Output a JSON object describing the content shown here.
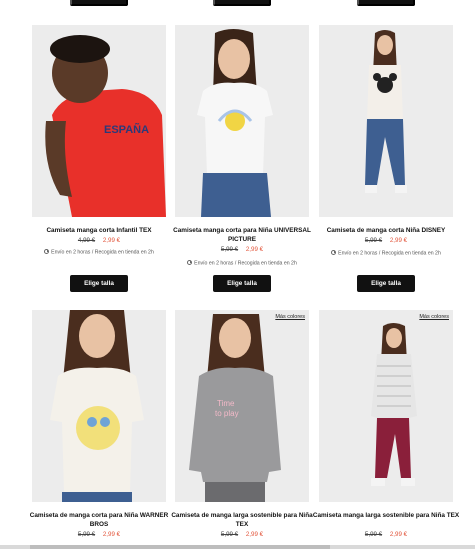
{
  "top_row": {
    "button_label": "Elige talla"
  },
  "products": [
    {
      "title": "Camiseta manga corta Infantil TEX",
      "old_price": "4,99 €",
      "new_price": "2,99 €",
      "shipping": "Envío en 2 horas / Recogida en tienda en 2h",
      "button_label": "Elige talla",
      "shirt_color": "#e8302a",
      "more_colors": ""
    },
    {
      "title": "Camiseta manga corta para Niña UNIVERSAL PICTURE",
      "old_price": "5,99 €",
      "new_price": "2,99 €",
      "shipping": "Envío en 2 horas / Recogida en tienda en 2h",
      "button_label": "Elige talla",
      "shirt_color": "#f7f7f7",
      "more_colors": ""
    },
    {
      "title": "Camiseta de manga corta Niña DISNEY",
      "old_price": "5,99 €",
      "new_price": "2,99 €",
      "shipping": "Envío en 2 horas / Recogida en tienda en 2h",
      "button_label": "Elige talla",
      "shirt_color": "#f3efe9",
      "more_colors": ""
    },
    {
      "title": "Camiseta de manga corta para Niña WARNER BROS",
      "old_price": "5,99 €",
      "new_price": "2,99 €",
      "shirt_color": "#f4f1ea",
      "more_colors": ""
    },
    {
      "title": "Camiseta de manga larga sostenible para Niña TEX",
      "old_price": "5,99 €",
      "new_price": "2,99 €",
      "shirt_color": "#9a9a9c",
      "more_colors": "Más colores"
    },
    {
      "title": "Camiseta manga larga sostenible para Niña TEX",
      "old_price": "5,99 €",
      "new_price": "2,99 €",
      "shirt_color": "#e6e6e6",
      "more_colors": "Más colores"
    }
  ]
}
